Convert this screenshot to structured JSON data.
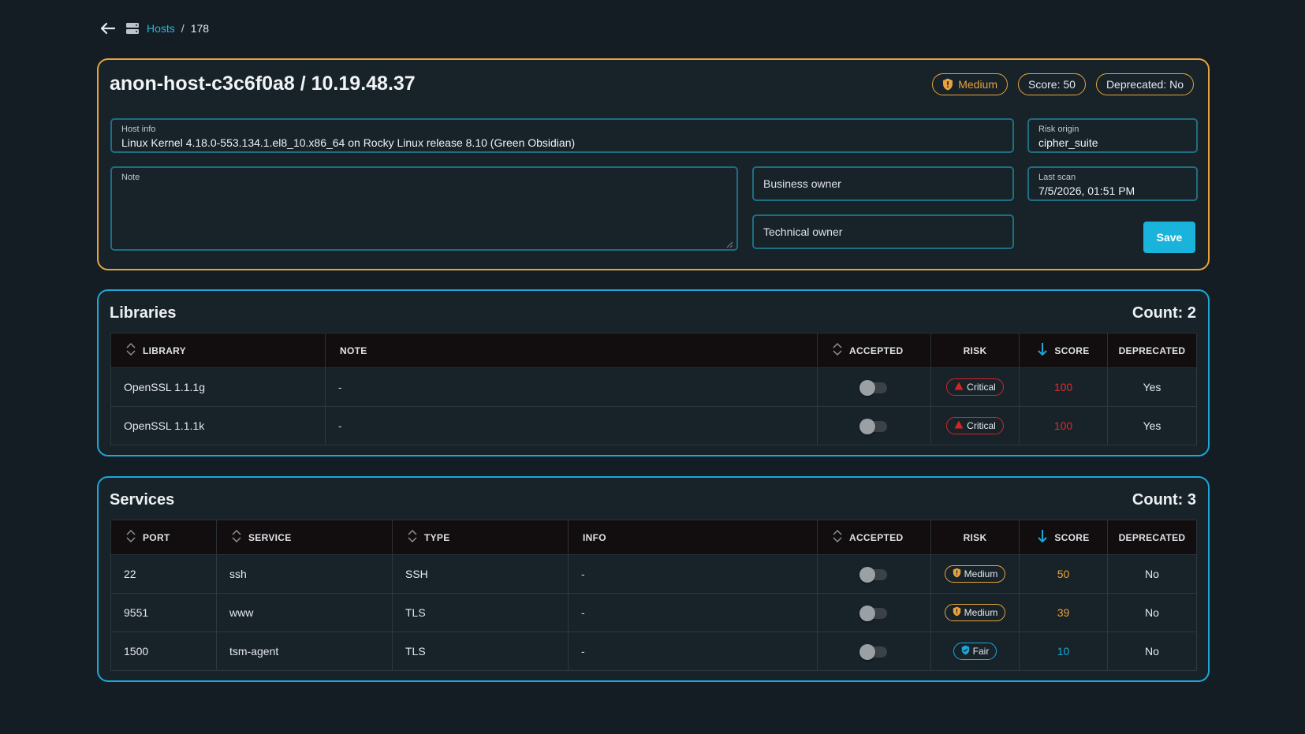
{
  "breadcrumb": {
    "parent": "Hosts",
    "separator": "/",
    "current": "178"
  },
  "host": {
    "title": "anon-host-c3c6f0a8 / 10.19.48.37",
    "risk_badge": "Medium",
    "score_badge": "Score: 50",
    "deprecated_badge": "Deprecated: No",
    "host_info": {
      "label": "Host info",
      "value": "Linux Kernel 4.18.0-553.134.1.el8_10.x86_64 on Rocky Linux release 8.10 (Green Obsidian)"
    },
    "risk_origin": {
      "label": "Risk origin",
      "value": "cipher_suite"
    },
    "note": {
      "label": "Note",
      "value": ""
    },
    "business_owner": {
      "placeholder": "Business owner"
    },
    "technical_owner": {
      "placeholder": "Technical owner"
    },
    "last_scan": {
      "label": "Last scan",
      "value": "7/5/2026, 01:51 PM"
    },
    "save_label": "Save"
  },
  "libraries": {
    "title": "Libraries",
    "count": "Count: 2",
    "headers": [
      "LIBRARY",
      "NOTE",
      "ACCEPTED",
      "RISK",
      "SCORE",
      "DEPRECATED"
    ],
    "rows": [
      {
        "library": "OpenSSL 1.1.1g",
        "note": "-",
        "accepted": false,
        "risk": "Critical",
        "score": "100",
        "deprecated": "Yes"
      },
      {
        "library": "OpenSSL 1.1.1k",
        "note": "-",
        "accepted": false,
        "risk": "Critical",
        "score": "100",
        "deprecated": "Yes"
      }
    ]
  },
  "services": {
    "title": "Services",
    "count": "Count: 3",
    "headers": [
      "PORT",
      "SERVICE",
      "TYPE",
      "INFO",
      "ACCEPTED",
      "RISK",
      "SCORE",
      "DEPRECATED"
    ],
    "rows": [
      {
        "port": "22",
        "service": "ssh",
        "type": "SSH",
        "info": "-",
        "accepted": false,
        "risk": "Medium",
        "score": "50",
        "deprecated": "No"
      },
      {
        "port": "9551",
        "service": "www",
        "type": "TLS",
        "info": "-",
        "accepted": false,
        "risk": "Medium",
        "score": "39",
        "deprecated": "No"
      },
      {
        "port": "1500",
        "service": "tsm-agent",
        "type": "TLS",
        "info": "-",
        "accepted": false,
        "risk": "Fair",
        "score": "10",
        "deprecated": "No"
      }
    ]
  },
  "colors": {
    "critical": "#e02b2b",
    "medium": "#e8a33d",
    "fair": "#1ea7d8",
    "accent": "#19b3dc"
  },
  "icons": [
    "back-arrow-icon",
    "host-server-icon",
    "shield-icon",
    "sort-icon",
    "sort-desc-icon",
    "warning-triangle-icon",
    "resize-handle-icon"
  ]
}
